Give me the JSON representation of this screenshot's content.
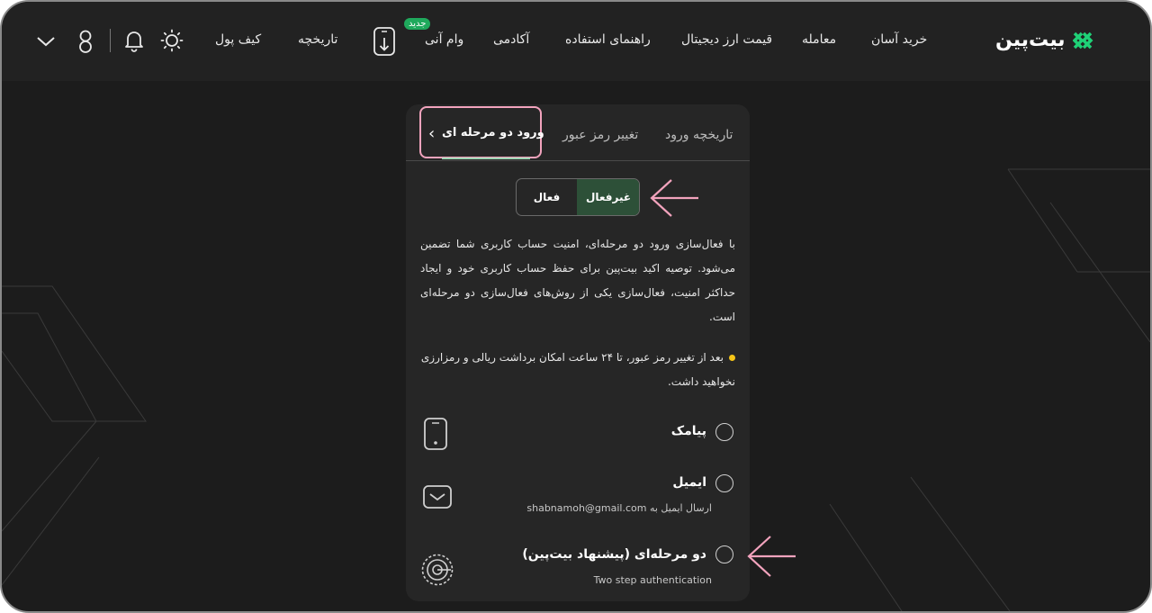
{
  "header": {
    "logo_text": "بیت‌پین",
    "nav": [
      {
        "label": "خرید آسان"
      },
      {
        "label": "معامله"
      },
      {
        "label": "قیمت ارز دیجیتال"
      },
      {
        "label": "راهنمای استفاده"
      },
      {
        "label": "آکادمی"
      },
      {
        "label": "وام آنی"
      },
      {
        "label": "تاریخچه"
      },
      {
        "label": "کیف پول"
      }
    ],
    "new_badge": "جدید",
    "icons": [
      "download-app-icon",
      "sun-icon",
      "bell-icon",
      "user-icon",
      "chevron-down-icon"
    ]
  },
  "tabs": {
    "login_history": "تاریخچه ورود",
    "change_password": "تغییر رمز عبور",
    "two_step": "ورود دو مرحله ای"
  },
  "toggle": {
    "inactive": "غیرفعال",
    "active": "فعال",
    "selected": "غیرفعال"
  },
  "description": "با فعال‌سازی ورود دو مرحله‌ای، امنیت حساب کاربری شما تضمین می‌شود. توصیه اکید بیت‌پین برای حفظ حساب کاربری خود و ایجاد حداکثر امنیت، فعال‌سازی یکی از روش‌های فعال‌سازی دو مرحله‌ای است.",
  "warning": "بعد از تغییر رمز عبور، تا ۲۴ ساعت امکان برداشت ریالی و رمزارزی نخواهید داشت.",
  "options": {
    "sms": {
      "label": "پیامک"
    },
    "email": {
      "label": "ایمیل",
      "sub": "ارسال ایمیل به shabnamoh@gmail.com"
    },
    "totp": {
      "label": "دو مرحله‌ای (پیشنهاد بیت‌پین)",
      "sub": "Two step authentication"
    }
  },
  "colors": {
    "accent_green": "#2d5038",
    "highlight_pink": "#f2a3bd",
    "badge_green": "#1fa95c",
    "warning_yellow": "#f5c518"
  }
}
